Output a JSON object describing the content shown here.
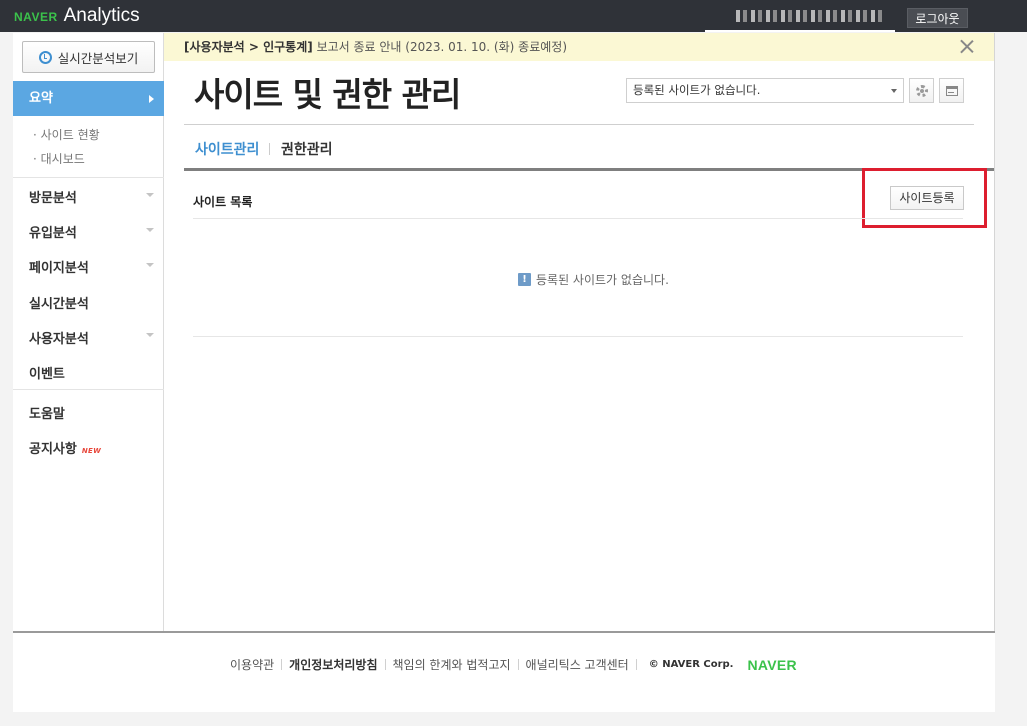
{
  "topbar": {
    "brand_naver": "NAVER",
    "brand_analytics": "Analytics",
    "logout_label": "로그아웃"
  },
  "sidebar": {
    "realtime_button": "실시간분석보기",
    "summary_label": "요약",
    "summary_subitems": [
      "· 사이트 현황",
      "· 대시보드"
    ],
    "items": [
      {
        "label": "방문분석",
        "expandable": true
      },
      {
        "label": "유입분석",
        "expandable": true
      },
      {
        "label": "페이지분석",
        "expandable": true
      },
      {
        "label": "실시간분석",
        "expandable": false
      },
      {
        "label": "사용자분석",
        "expandable": true
      },
      {
        "label": "이벤트",
        "expandable": false
      }
    ],
    "help_label": "도움말",
    "notice_label": "공지사항",
    "new_badge": "NEW"
  },
  "notice": {
    "bold_text": "[사용자분석 > 인구통계]",
    "text": " 보고서 종료 안내 (2023. 01. 10. (화) 종료예정)"
  },
  "main": {
    "title": "사이트 및 권한 관리",
    "site_select_value": "등록된 사이트가 없습니다.",
    "tabs": [
      {
        "label": "사이트관리",
        "active": true
      },
      {
        "label": "권한관리",
        "active": false
      }
    ],
    "section_title": "사이트 목록",
    "register_button": "사이트등록",
    "empty_icon": "!",
    "empty_message": "등록된 사이트가 없습니다."
  },
  "colors": {
    "accent_blue": "#3e8fd0",
    "sidebar_active": "#5ba7e2",
    "brand_green": "#3bc24b",
    "highlight_red": "#dd1e2f",
    "notice_bg": "#fbf8d4"
  },
  "footer": {
    "links": [
      "이용약관",
      "개인정보처리방침",
      "책임의 한계와 법적고지",
      "애널리틱스 고객센터"
    ],
    "corp": "© NAVER Corp.",
    "logo": "NAVER"
  }
}
